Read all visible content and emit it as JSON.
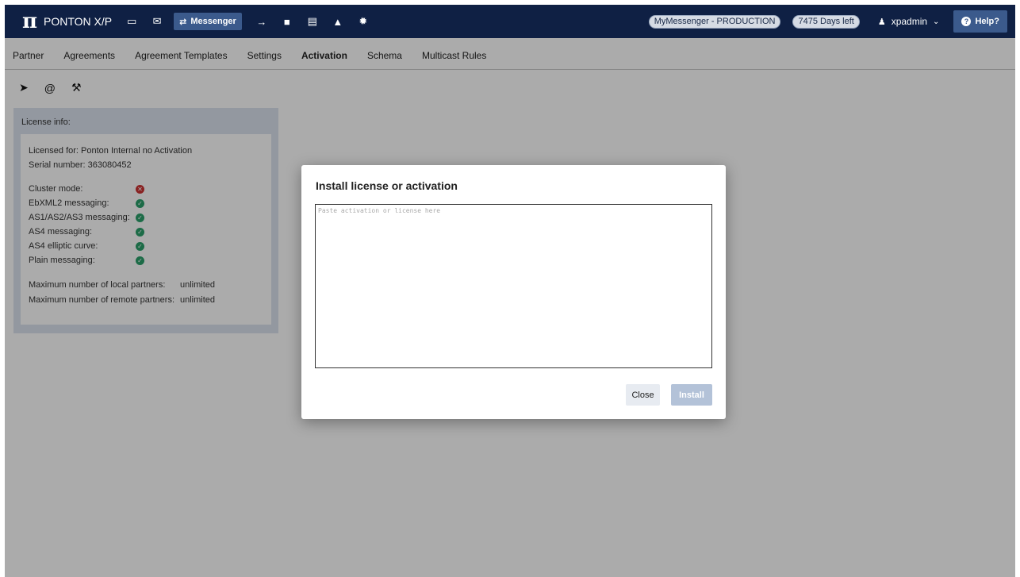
{
  "topbar": {
    "logo_symbol": "π",
    "app_name": "PONTON X/P",
    "icons": [
      "monitor-icon",
      "mail-icon",
      "arrow-route-icon",
      "folder-icon",
      "dashboard-icon",
      "flask-icon",
      "gear-icon"
    ],
    "active_module": "Messenger",
    "environment": "MyMessenger - PRODUCTION",
    "days_left": "7475 Days left",
    "user": "xpadmin",
    "help": "Help?"
  },
  "subnav": {
    "items": [
      "Partner",
      "Agreements",
      "Agreement Templates",
      "Settings",
      "Activation",
      "Schema",
      "Multicast Rules"
    ],
    "active": "Activation"
  },
  "tools": [
    "send-icon",
    "at-icon",
    "wrench-icon"
  ],
  "license": {
    "header": "License info:",
    "licensed_for": "Licensed for: Ponton Internal no Activation",
    "serial": "Serial number: 363080452",
    "features": [
      {
        "label": "Cluster mode:",
        "enabled": false
      },
      {
        "label": "EbXML2 messaging:",
        "enabled": true
      },
      {
        "label": "AS1/AS2/AS3 messaging:",
        "enabled": true
      },
      {
        "label": "AS4 messaging:",
        "enabled": true
      },
      {
        "label": "AS4 elliptic curve:",
        "enabled": true
      },
      {
        "label": "Plain messaging:",
        "enabled": true
      }
    ],
    "limits": [
      {
        "label": "Maximum number of local partners:",
        "value": "unlimited"
      },
      {
        "label": "Maximum number of remote partners:",
        "value": "unlimited"
      }
    ]
  },
  "modal": {
    "title": "Install license or activation",
    "placeholder": "Paste activation or license here",
    "value": "",
    "close_label": "Close",
    "install_label": "Install"
  }
}
